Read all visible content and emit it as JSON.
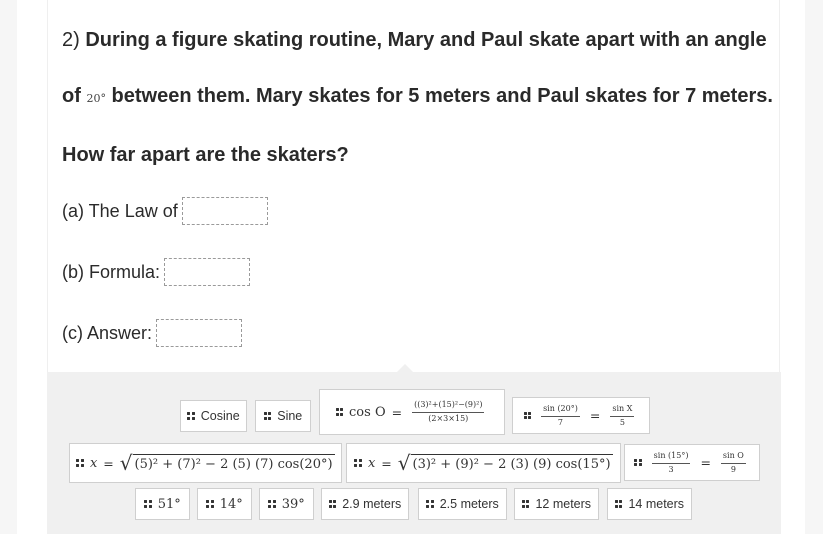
{
  "question": {
    "number": "2)",
    "text_before_angle": "During a figure skating routine, Mary and Paul skate apart with an angle of",
    "angle": "20°",
    "text_after_angle": "between them. Mary skates for 5 meters and Paul skates for 7 meters. How far apart are the skaters?"
  },
  "answers": [
    {
      "label": "(a) The Law of",
      "value": ""
    },
    {
      "label": "(b) Formula:",
      "value": ""
    },
    {
      "label": "(c) Answer:",
      "value": ""
    }
  ],
  "tiles": {
    "cosine": "Cosine",
    "sine": "Sine",
    "cos_o_formula": {
      "lhs": "cos O",
      "numerator": "((3)²+(15)²−(9)²)",
      "denominator": "(2×3×15)"
    },
    "sin_ratio_20": {
      "left_num": "sin (20°)",
      "left_den": "7",
      "right_num": "sin X",
      "right_den": "5"
    },
    "law_cos_5_7": {
      "lhs": "x",
      "radicand": "(5)² + (7)² − 2 (5) (7) cos(20°)"
    },
    "law_cos_3_9": {
      "lhs": "x",
      "radicand": "(3)² + (9)² − 2 (3) (9) cos(15°)"
    },
    "sin_ratio_15": {
      "left_num": "sin (15°)",
      "left_den": "3",
      "right_num": "sin O",
      "right_den": "9"
    },
    "angle_51": "51°",
    "angle_14": "14°",
    "angle_39": "39°",
    "dist_2_9": "2.9 meters",
    "dist_2_5": "2.5 meters",
    "dist_12": "12 meters",
    "dist_14": "14 meters"
  }
}
